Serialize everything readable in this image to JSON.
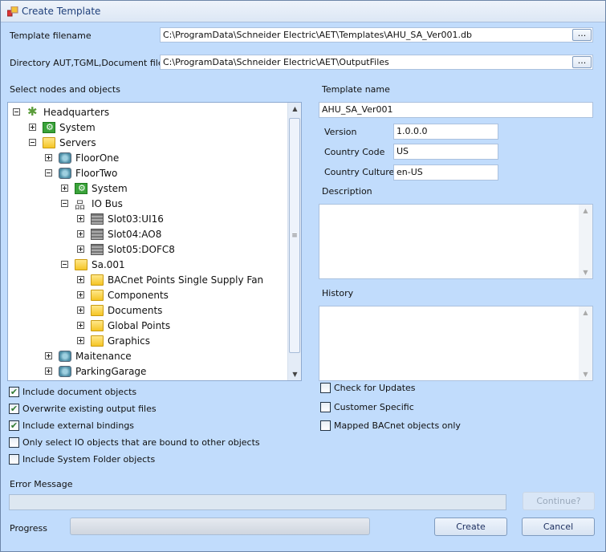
{
  "window": {
    "title": "Create Template"
  },
  "fields": {
    "template_filename_label": "Template filename",
    "template_filename_value": "C:\\ProgramData\\Schneider Electric\\AET\\Templates\\AHU_SA_Ver001.db",
    "directory_label": "Directory AUT,TGML,Document files",
    "directory_value": "C:\\ProgramData\\Schneider Electric\\AET\\OutputFiles",
    "browse_label": "...",
    "select_nodes_label": "Select nodes and objects"
  },
  "tree": [
    {
      "label": "Headquarters",
      "level": 0,
      "expanded": true,
      "icon": "network"
    },
    {
      "label": "System",
      "level": 1,
      "expanded": false,
      "icon": "system"
    },
    {
      "label": "Servers",
      "level": 1,
      "expanded": true,
      "icon": "folder"
    },
    {
      "label": "FloorOne",
      "level": 2,
      "expanded": false,
      "icon": "server"
    },
    {
      "label": "FloorTwo",
      "level": 2,
      "expanded": true,
      "icon": "server"
    },
    {
      "label": "System",
      "level": 3,
      "expanded": false,
      "icon": "system"
    },
    {
      "label": "IO Bus",
      "level": 3,
      "expanded": true,
      "icon": "bus"
    },
    {
      "label": "Slot03:UI16",
      "level": 4,
      "expanded": false,
      "icon": "module"
    },
    {
      "label": "Slot04:AO8",
      "level": 4,
      "expanded": false,
      "icon": "module"
    },
    {
      "label": "Slot05:DOFC8",
      "level": 4,
      "expanded": false,
      "icon": "module"
    },
    {
      "label": "Sa.001",
      "level": 3,
      "expanded": true,
      "icon": "folder"
    },
    {
      "label": "BACnet Points Single Supply Fan",
      "level": 4,
      "expanded": false,
      "icon": "folder"
    },
    {
      "label": "Components",
      "level": 4,
      "expanded": false,
      "icon": "folder"
    },
    {
      "label": "Documents",
      "level": 4,
      "expanded": false,
      "icon": "folder"
    },
    {
      "label": "Global Points",
      "level": 4,
      "expanded": false,
      "icon": "folder"
    },
    {
      "label": "Graphics",
      "level": 4,
      "expanded": false,
      "icon": "folder"
    },
    {
      "label": "Maitenance",
      "level": 2,
      "expanded": false,
      "icon": "server"
    },
    {
      "label": "ParkingGarage",
      "level": 2,
      "expanded": false,
      "icon": "server"
    }
  ],
  "options_left": [
    {
      "label": "Include document objects",
      "checked": true
    },
    {
      "label": "Overwrite existing output files",
      "checked": true
    },
    {
      "label": "Include external bindings",
      "checked": true
    },
    {
      "label": "Only select IO objects that are bound to other objects",
      "checked": false
    },
    {
      "label": "Include System Folder objects",
      "checked": false
    }
  ],
  "template": {
    "name_label": "Template name",
    "name_value": "AHU_SA_Ver001",
    "version_label": "Version",
    "version_value": "1.0.0.0",
    "country_code_label": "Country Code",
    "country_code_value": "US",
    "country_culture_label": "Country Culture",
    "country_culture_value": "en-US",
    "description_label": "Description",
    "history_label": "History"
  },
  "options_right": [
    {
      "label": "Check for Updates",
      "checked": false
    },
    {
      "label": "Customer Specific",
      "checked": false
    },
    {
      "label": "Mapped BACnet objects only",
      "checked": false
    }
  ],
  "footer": {
    "error_label": "Error Message",
    "progress_label": "Progress",
    "progress": 0,
    "continue_label": "Continue?",
    "create_label": "Create",
    "cancel_label": "Cancel"
  }
}
